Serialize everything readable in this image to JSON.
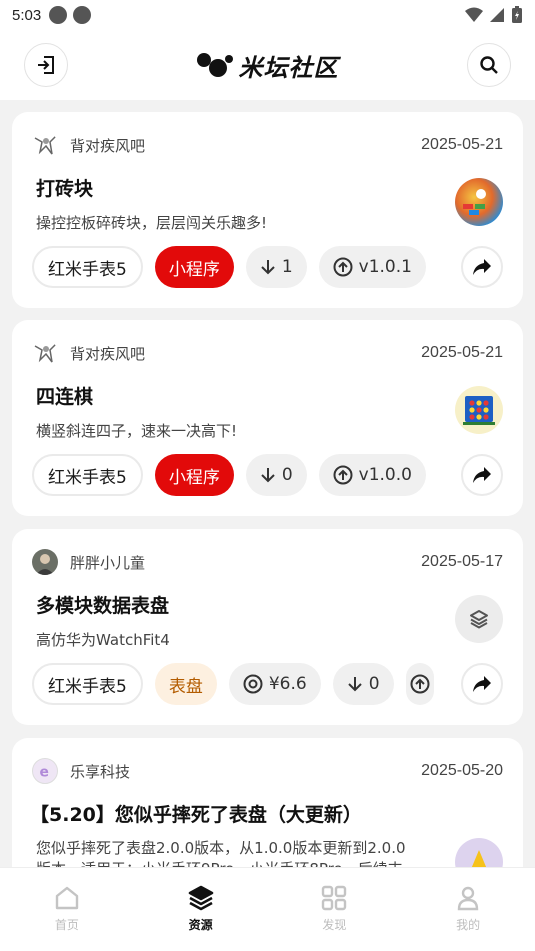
{
  "status_bar": {
    "time": "5:03"
  },
  "header": {
    "title": "米坛社区"
  },
  "cards": [
    {
      "author": "背对疾风吧",
      "date": "2025-05-21",
      "title": "打砖块",
      "desc": "操控控板碎砖块，层层闯关乐趣多!",
      "device": "红米手表5",
      "type": "小程序",
      "downloads": "1",
      "version": "v1.0.1"
    },
    {
      "author": "背对疾风吧",
      "date": "2025-05-21",
      "title": "四连棋",
      "desc": "横竖斜连四子，速来一决高下!",
      "device": "红米手表5",
      "type": "小程序",
      "downloads": "0",
      "version": "v1.0.0"
    },
    {
      "author": "胖胖小儿童",
      "date": "2025-05-17",
      "title": "多模块数据表盘",
      "desc": "高仿华为WatchFit4",
      "device": "红米手表5",
      "type": "表盘",
      "price": "¥6.6",
      "downloads": "0"
    },
    {
      "author": "乐享科技",
      "date": "2025-05-20",
      "title": "【5.20】您似乎摔死了表盘（大更新）",
      "desc_line1": "您似乎摔死了表盘2.0.0版本，从1.0.0版本更新到2.0.0",
      "desc_line2": "版本。适用于：小米手环9Pro、小米手环8Pro，后续支"
    }
  ],
  "tabbar": {
    "items": [
      {
        "label": "首页",
        "icon": "home-icon"
      },
      {
        "label": "资源",
        "icon": "layers-icon"
      },
      {
        "label": "发现",
        "icon": "grid-icon"
      },
      {
        "label": "我的",
        "icon": "person-icon"
      }
    ],
    "active_index": 1
  },
  "colors": {
    "accent_red": "#e20a0a",
    "peach_bg": "#fdf0e0",
    "peach_text": "#b35c00"
  }
}
